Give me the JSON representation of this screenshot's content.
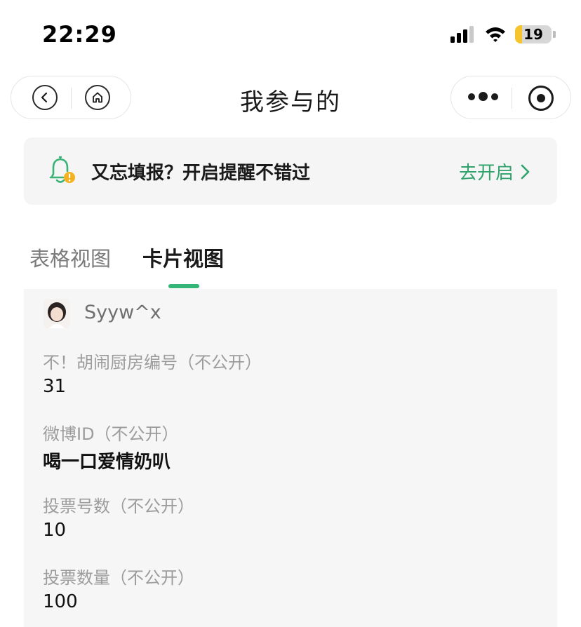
{
  "status_bar": {
    "time": "22:29",
    "battery_level": "19",
    "battery_fraction": 0.19,
    "icons": [
      "cellular-signal-icon",
      "wifi-icon",
      "battery-icon"
    ]
  },
  "nav": {
    "title": "我参与的",
    "left_icons": [
      "back-arrow-icon",
      "home-icon"
    ],
    "right_icons": [
      "more-dots-icon",
      "close-miniprogram-icon"
    ]
  },
  "reminder": {
    "text": "又忘填报？开启提醒不错过",
    "action_label": "去开启",
    "icon": "bell-warning-icon",
    "accent_color": "#2fa36b"
  },
  "tabs": [
    {
      "label": "表格视图",
      "active": false
    },
    {
      "label": "卡片视图",
      "active": true
    }
  ],
  "tab_indicator_color": "#33b577",
  "card": {
    "user_name": "Syyw^x",
    "fields": [
      {
        "label": "不！胡闹厨房编号（不公开）",
        "value": "31"
      },
      {
        "label": "微博ID（不公开）",
        "value": "喝一口爱情奶叭"
      },
      {
        "label": "投票号数（不公开）",
        "value": "10"
      },
      {
        "label": "投票数量（不公开）",
        "value": "100"
      }
    ]
  }
}
